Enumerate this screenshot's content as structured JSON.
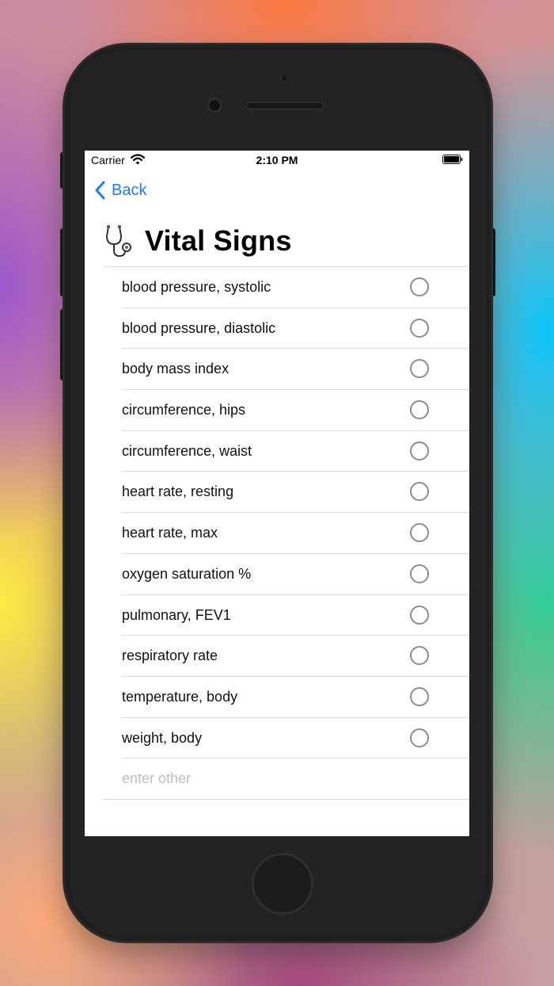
{
  "status_bar": {
    "carrier": "Carrier",
    "time": "2:10 PM"
  },
  "nav": {
    "back_label": "Back"
  },
  "page": {
    "title": "Vital Signs",
    "title_icon": "stethoscope-icon"
  },
  "items": [
    {
      "label": "blood pressure, systolic",
      "selected": false
    },
    {
      "label": "blood pressure, diastolic",
      "selected": false
    },
    {
      "label": "body mass index",
      "selected": false
    },
    {
      "label": "circumference, hips",
      "selected": false
    },
    {
      "label": "circumference, waist",
      "selected": false
    },
    {
      "label": "heart rate, resting",
      "selected": false
    },
    {
      "label": "heart rate, max",
      "selected": false
    },
    {
      "label": "oxygen saturation %",
      "selected": false
    },
    {
      "label": "pulmonary, FEV1",
      "selected": false
    },
    {
      "label": "respiratory rate",
      "selected": false
    },
    {
      "label": "temperature, body",
      "selected": false
    },
    {
      "label": "weight, body",
      "selected": false
    }
  ],
  "other_input": {
    "placeholder": "enter other",
    "value": ""
  },
  "colors": {
    "accent": "#1a7cf5",
    "radio_border": "#8c8c8c",
    "separator": "#dcdcdc"
  }
}
